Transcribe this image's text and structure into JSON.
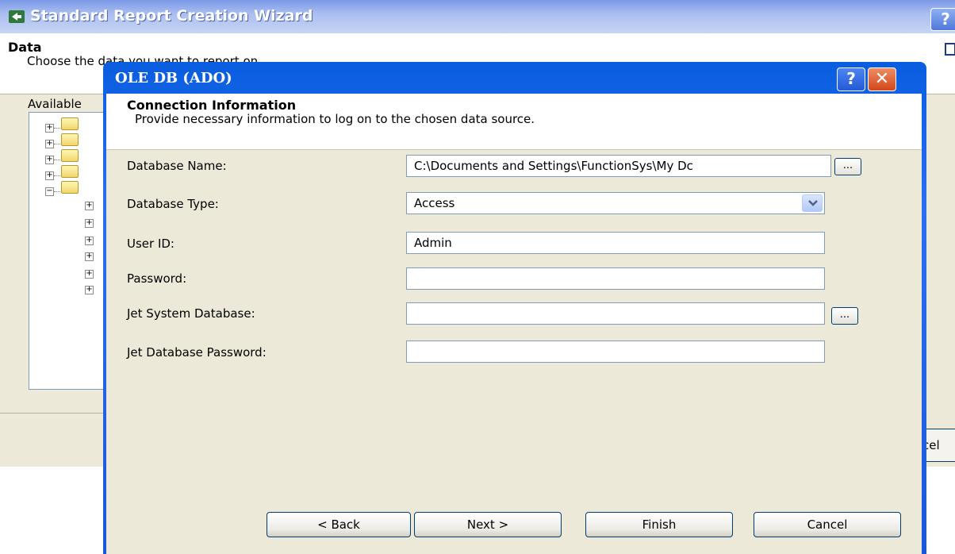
{
  "wizard": {
    "title": "Standard Report Creation Wizard",
    "header_title": "Data",
    "header_subtitle": "Choose the data you want to report on",
    "available_label": "Available",
    "cancel_partial": "cel",
    "help_glyph": "?"
  },
  "dialog": {
    "title": "OLE DB (ADO)",
    "help_glyph": "?",
    "close_glyph": "✕",
    "header_title": "Connection Information",
    "header_subtitle": "Provide necessary information to log on to the chosen data source.",
    "fields": {
      "database_name": {
        "label": "Database Name:",
        "value": "C:\\Documents and Settings\\FunctionSys\\My Dc"
      },
      "database_type": {
        "label": "Database Type:",
        "value": "Access"
      },
      "user_id": {
        "label": "User ID:",
        "value": "Admin"
      },
      "password": {
        "label": "Password:",
        "value": ""
      },
      "jet_system_database": {
        "label": "Jet System Database:",
        "value": ""
      },
      "jet_database_password": {
        "label": "Jet Database Password:",
        "value": ""
      }
    },
    "browse_label": "...",
    "buttons": {
      "back": "< Back",
      "next": "Next >",
      "finish": "Finish",
      "cancel": "Cancel"
    }
  },
  "icons": [
    "app-icon",
    "help-icon",
    "close-icon",
    "folder-icon",
    "expand-icon",
    "collapse-icon",
    "chevron-down-icon"
  ],
  "colors": {
    "titlebar_blue": "#1a57d8",
    "close_red": "#d2461a",
    "dialog_bg": "#ece9d8"
  }
}
